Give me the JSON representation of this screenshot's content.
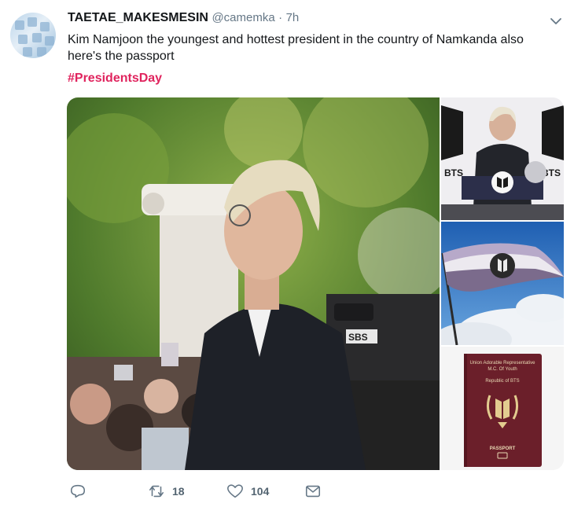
{
  "tweet": {
    "display_name": "TAETAE_MAKESMESIN",
    "handle": "@camemka",
    "separator": "·",
    "time": "7h",
    "text": "Kim Namjoon the youngest and hottest president in the country of Namkanda also here's the passport",
    "hashtag": "#PresidentsDay"
  },
  "media": {
    "main_photo_text": "SBS",
    "thumb1_text": [
      "BTS",
      "BTS"
    ],
    "passport": {
      "line1": "Union Adorable Representative",
      "line2": "M.C. Of Youth",
      "line3": "Republic of BTS",
      "label": "PASSPORT"
    }
  },
  "actions": {
    "reply_icon": "reply-icon",
    "retweet_icon": "retweet-icon",
    "retweet_count": "18",
    "like_icon": "heart-icon",
    "like_count": "104",
    "dm_icon": "envelope-icon"
  },
  "colors": {
    "hashtag": "#e0245e",
    "secondary_text": "#657786",
    "passport_cover": "#6b1f2a"
  }
}
